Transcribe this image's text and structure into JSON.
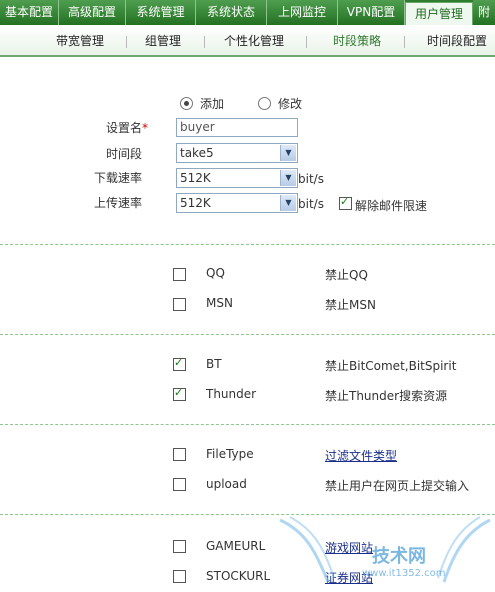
{
  "top_tabs": [
    {
      "label": "基本配置"
    },
    {
      "label": "高级配置"
    },
    {
      "label": "系统管理"
    },
    {
      "label": "系统状态"
    },
    {
      "label": "上网监控"
    },
    {
      "label": "VPN配置"
    },
    {
      "label": "用户管理",
      "active": true
    },
    {
      "label": "附"
    }
  ],
  "sub_tabs": [
    {
      "label": "带宽管理"
    },
    {
      "label": "组管理"
    },
    {
      "label": "个性化管理"
    },
    {
      "label": "时段策略",
      "active": true
    },
    {
      "label": "时间段配置"
    }
  ],
  "form": {
    "mode_add": "添加",
    "mode_edit": "修改",
    "selected_mode": "添加",
    "name_label": "设置名",
    "required_mark": "*",
    "name_value": "buyer",
    "period_label": "时间段",
    "period_value": "take5",
    "download_label": "下载速率",
    "download_value": "512K",
    "download_unit": "bit/s",
    "upload_label": "上传速率",
    "upload_value": "512K",
    "upload_unit": "bit/s",
    "mail_limit_label": "解除邮件限速",
    "mail_limit_checked": true
  },
  "rules": [
    {
      "name": "QQ",
      "desc": "禁止QQ",
      "checked": false,
      "link": false
    },
    {
      "name": "MSN",
      "desc": "禁止MSN",
      "checked": false,
      "link": false
    },
    {
      "name": "BT",
      "desc": "禁止BitComet,BitSpirit",
      "checked": true,
      "link": false
    },
    {
      "name": "Thunder",
      "desc": "禁止Thunder搜索资源",
      "checked": true,
      "link": false
    },
    {
      "name": "FileType",
      "desc": "过滤文件类型",
      "checked": false,
      "link": true
    },
    {
      "name": "upload",
      "desc": "禁止用户在网页上提交输入",
      "checked": false,
      "link": false
    },
    {
      "name": "GAMEURL",
      "desc": "游戏网站",
      "checked": false,
      "link": true
    },
    {
      "name": "STOCKURL",
      "desc": "证券网站",
      "checked": false,
      "link": true
    }
  ],
  "watermark": {
    "main": "技术网",
    "sub": "www.it1352.com"
  },
  "colors": {
    "nav_green": "#2f7d2f",
    "active_text": "#2d7a2d",
    "link": "#1a2f8a",
    "check": "#177a17"
  }
}
